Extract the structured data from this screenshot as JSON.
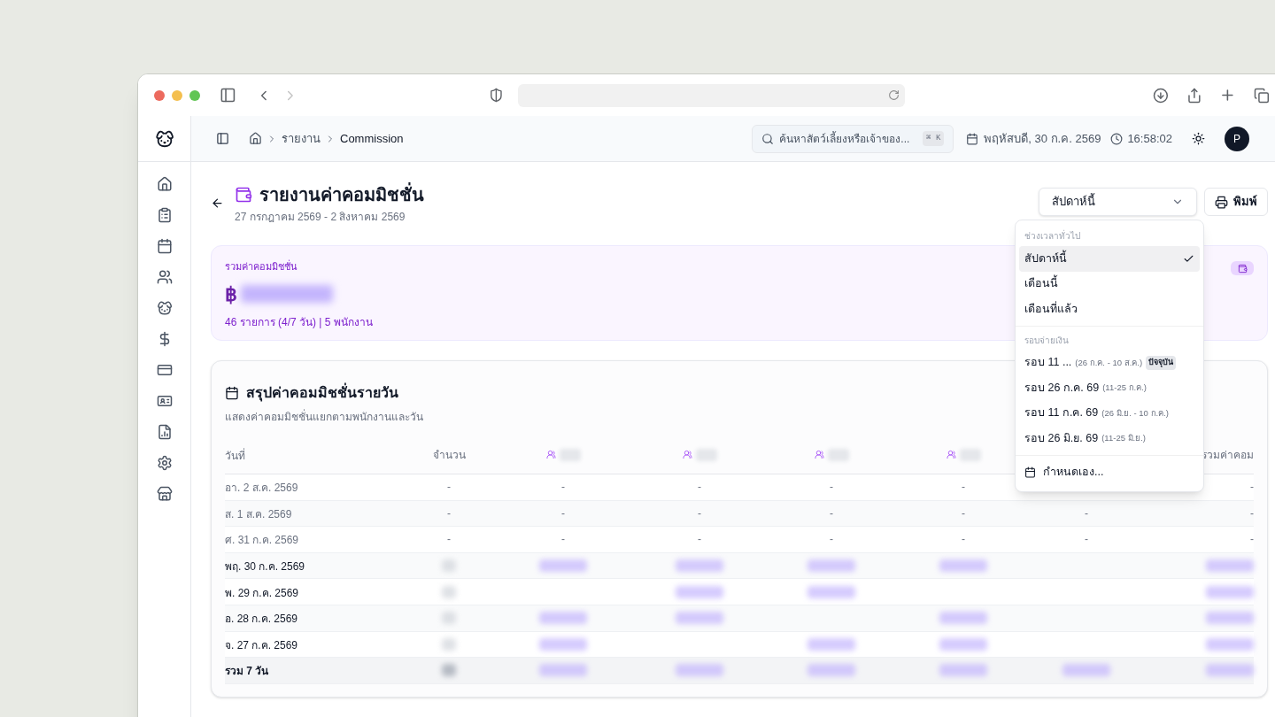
{
  "app_header": {
    "breadcrumb": [
      "รายงาน",
      "Commission"
    ],
    "search": {
      "placeholder": "ค้นหาสัตว์เลี้ยงหรือเจ้าของ...",
      "shortcut": "⌘ K"
    },
    "date": "พฤหัสบดี, 30 ก.ค. 2569",
    "time": "16:58:02",
    "avatar": "P"
  },
  "page": {
    "title": "รายงานค่าคอมมิชชั่น",
    "subtitle": "27 กรกฎาคม 2569 - 2 สิงหาคม 2569",
    "period_select": {
      "value": "สัปดาห์นี้",
      "expanded": true
    },
    "print_button": "พิมพ์"
  },
  "dropdown": {
    "groups": [
      {
        "heading": "ช่วงเวลาทั่วไป",
        "items": [
          {
            "label": "สัปดาห์นี้",
            "selected": true
          },
          {
            "label": "เดือนนี้",
            "selected": false
          },
          {
            "label": "เดือนที่แล้ว",
            "selected": false
          }
        ]
      },
      {
        "heading": "รอบจ่ายเงิน",
        "items": [
          {
            "label": "รอบ 11 ...",
            "range": "(26 ก.ค. - 10 ส.ค.)",
            "badge": "ปัจจุบัน",
            "selected": false
          },
          {
            "label": "รอบ 26 ก.ค. 69",
            "range": "(11-25 ก.ค.)",
            "selected": false
          },
          {
            "label": "รอบ 11 ก.ค. 69",
            "range": "(26 มิ.ย. - 10 ก.ค.)",
            "selected": false
          },
          {
            "label": "รอบ 26 มิ.ย. 69",
            "range": "(11-25 มิ.ย.)",
            "selected": false
          }
        ]
      }
    ],
    "custom": "กำหนดเอง..."
  },
  "summary": {
    "label": "รวมค่าคอมมิชชั่น",
    "currency": "฿",
    "amount_redacted": true,
    "detail": "46 รายการ (4/7 วัน) | 5 พนักงาน"
  },
  "daily": {
    "title": "สรุปค่าคอมมิชชั่นรายวัน",
    "subtitle": "แสดงค่าคอมมิชชั่นแยกตามพนักงานและวัน",
    "columns": [
      {
        "kind": "text",
        "label": "วันที่"
      },
      {
        "kind": "text",
        "label": "จำนวน"
      },
      {
        "kind": "employee"
      },
      {
        "kind": "employee"
      },
      {
        "kind": "employee"
      },
      {
        "kind": "employee"
      },
      {
        "kind": "covered"
      },
      {
        "kind": "text",
        "label": "รวมค่าคอม"
      }
    ],
    "rows": [
      {
        "has_data": false,
        "total": false,
        "cells": [
          "อา. 2 ส.ค. 2569",
          "-",
          "-",
          "-",
          "-",
          "-",
          {
            "kind": "empty"
          },
          "-"
        ]
      },
      {
        "has_data": false,
        "total": false,
        "cells": [
          "ส. 1 ส.ค. 2569",
          "-",
          "-",
          "-",
          "-",
          "-",
          "-",
          "-"
        ]
      },
      {
        "has_data": false,
        "total": false,
        "cells": [
          "ศ. 31 ก.ค. 2569",
          "-",
          "-",
          "-",
          "-",
          "-",
          "-",
          "-"
        ]
      },
      {
        "has_data": true,
        "total": false,
        "cells": [
          "พฤ. 30 ก.ค. 2569",
          {
            "kind": "redacted"
          },
          {
            "kind": "redacted"
          },
          {
            "kind": "redacted"
          },
          {
            "kind": "redacted"
          },
          {
            "kind": "redacted"
          },
          {
            "kind": "empty"
          },
          {
            "kind": "redacted"
          }
        ]
      },
      {
        "has_data": true,
        "total": false,
        "cells": [
          "พ. 29 ก.ค. 2569",
          {
            "kind": "redacted"
          },
          {
            "kind": "empty"
          },
          {
            "kind": "redacted"
          },
          {
            "kind": "redacted"
          },
          {
            "kind": "empty"
          },
          {
            "kind": "empty"
          },
          {
            "kind": "redacted"
          }
        ]
      },
      {
        "has_data": true,
        "total": false,
        "cells": [
          "อ. 28 ก.ค. 2569",
          {
            "kind": "redacted"
          },
          {
            "kind": "redacted"
          },
          {
            "kind": "redacted"
          },
          {
            "kind": "empty"
          },
          {
            "kind": "redacted"
          },
          {
            "kind": "empty"
          },
          {
            "kind": "redacted"
          }
        ]
      },
      {
        "has_data": true,
        "total": false,
        "cells": [
          "จ. 27 ก.ค. 2569",
          {
            "kind": "redacted"
          },
          {
            "kind": "redacted"
          },
          {
            "kind": "empty"
          },
          {
            "kind": "redacted"
          },
          {
            "kind": "redacted"
          },
          {
            "kind": "empty"
          },
          {
            "kind": "redacted"
          }
        ]
      },
      {
        "has_data": true,
        "total": true,
        "cells": [
          "รวม 7 วัน",
          {
            "kind": "redacted"
          },
          {
            "kind": "redacted"
          },
          {
            "kind": "redacted"
          },
          {
            "kind": "redacted"
          },
          {
            "kind": "redacted"
          },
          {
            "kind": "redacted"
          },
          {
            "kind": "redacted"
          }
        ]
      }
    ]
  }
}
